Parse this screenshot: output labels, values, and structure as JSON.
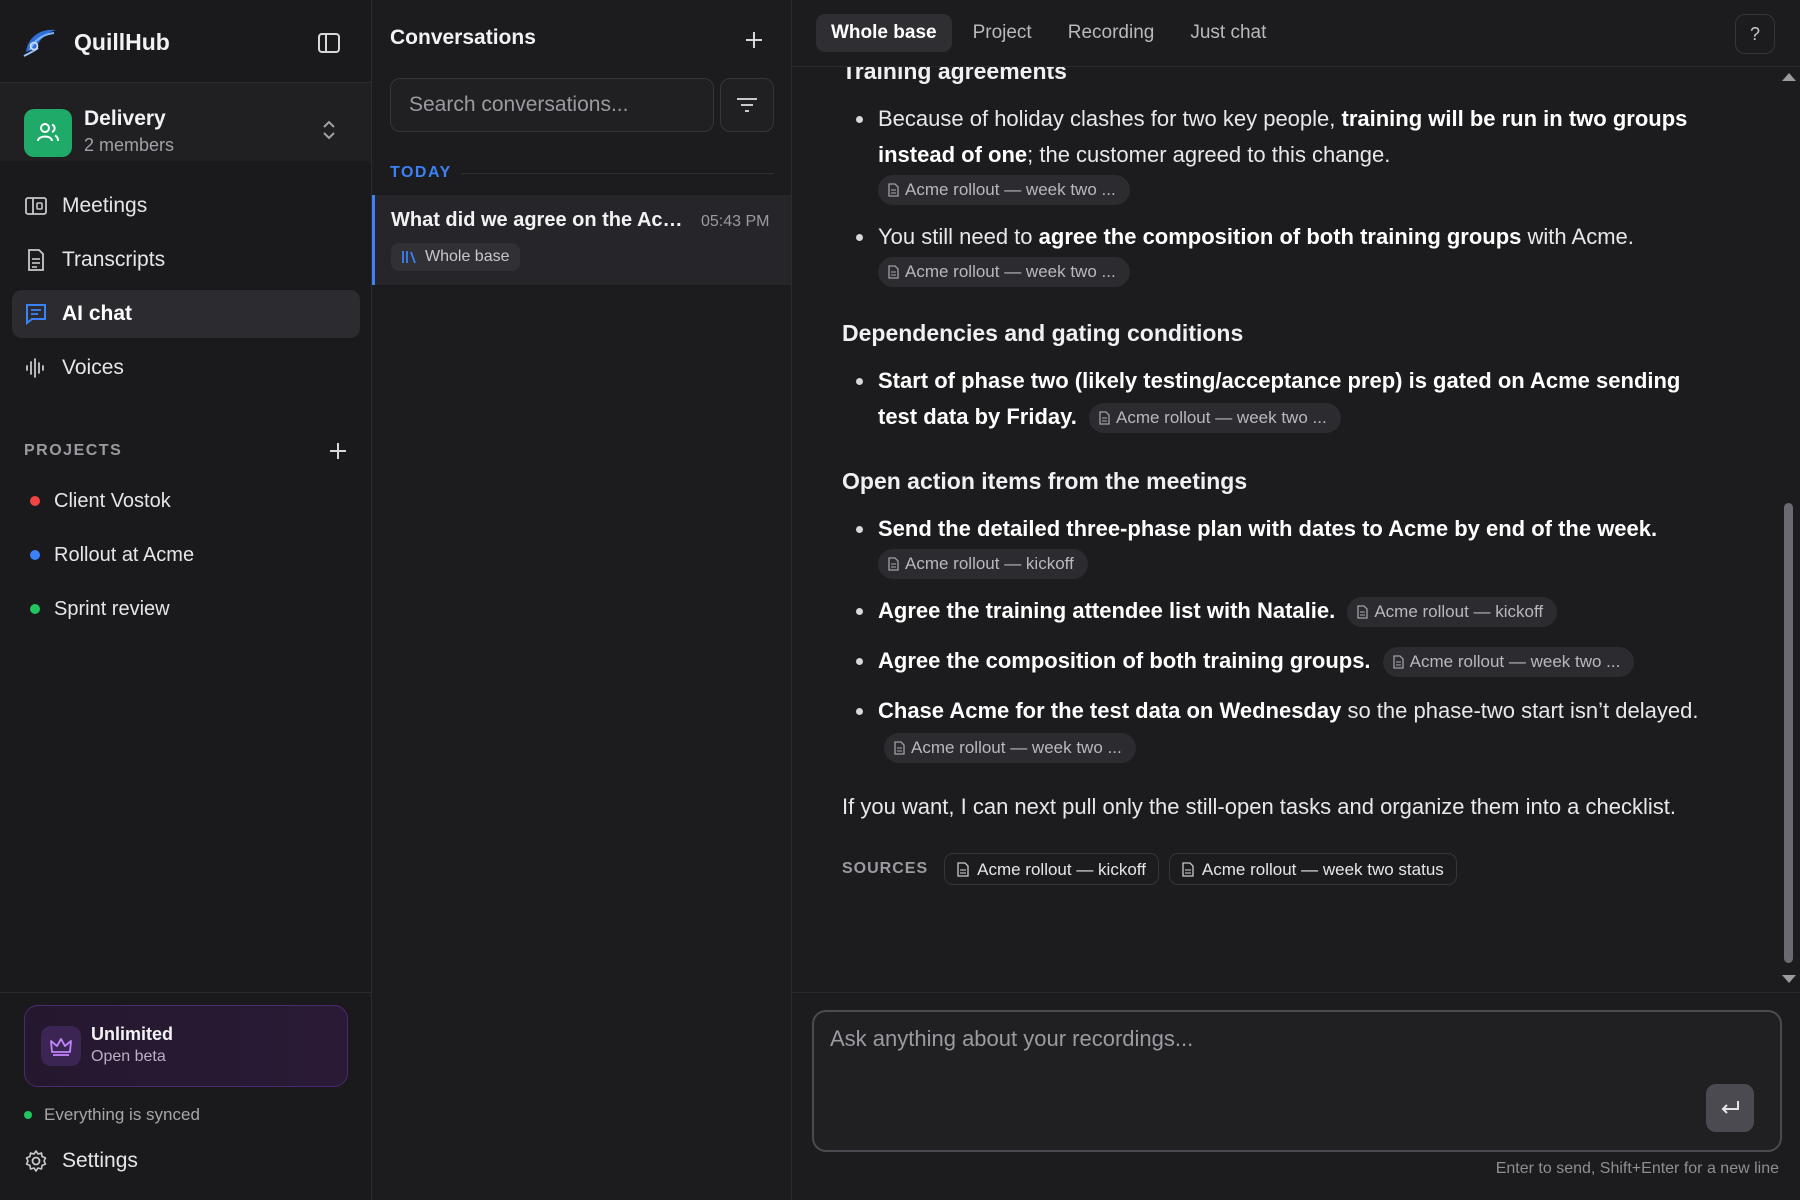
{
  "app": {
    "name": "QuillHub"
  },
  "workspace": {
    "name": "Delivery",
    "members": "2 members"
  },
  "nav": {
    "meetings": "Meetings",
    "transcripts": "Transcripts",
    "ai_chat": "AI chat",
    "voices": "Voices"
  },
  "projects": {
    "label": "PROJECTS",
    "items": [
      {
        "name": "Client Vostok",
        "color": "#ef4444"
      },
      {
        "name": "Rollout at Acme",
        "color": "#3b82f6"
      },
      {
        "name": "Sprint review",
        "color": "#22c55e"
      }
    ]
  },
  "plan": {
    "title": "Unlimited",
    "subtitle": "Open beta"
  },
  "sync_status": "Everything is synced",
  "settings_label": "Settings",
  "conversations": {
    "title": "Conversations",
    "search_placeholder": "Search conversations...",
    "group_label": "TODAY",
    "items": [
      {
        "title": "What did we agree on the Acme rollout?",
        "time": "05:43 PM",
        "scope": "Whole base"
      }
    ]
  },
  "tabs": [
    "Whole base",
    "Project",
    "Recording",
    "Just chat"
  ],
  "help_label": "?",
  "message": {
    "section_training": "Training agreements",
    "training_1_pre": "Because of holiday clashes for two key people, ",
    "training_1_bold": "training will be run in two groups instead of one",
    "training_1_post": "; the customer agreed to this change.",
    "training_1_cite": "Acme rollout — week two ...",
    "training_2_pre": "You still need to ",
    "training_2_bold": "agree the composition of both training groups",
    "training_2_post": " with Acme.",
    "training_2_cite": "Acme rollout — week two ...",
    "section_deps": "Dependencies and gating conditions",
    "deps_1_bold": "Start of phase two (likely testing/acceptance prep) is gated on Acme sending test data by Friday.",
    "deps_1_cite": "Acme rollout — week two ...",
    "section_actions": "Open action items from the meetings",
    "action_1_bold": "Send the detailed three-phase plan with dates to Acme by end of the week.",
    "action_1_cite": "Acme rollout — kickoff",
    "action_2_bold": "Agree the training attendee list with Natalie.",
    "action_2_cite": "Acme rollout — kickoff",
    "action_3_bold": "Agree the composition of both training groups.",
    "action_3_cite": "Acme rollout — week two ...",
    "action_4_bold": "Chase Acme for the test data on Wednesday",
    "action_4_post": " so the phase-two start isn’t delayed.",
    "action_4_cite": "Acme rollout — week two ...",
    "closing": "If you want, I can next pull only the still-open tasks and organize them into a checklist.",
    "sources_label": "SOURCES",
    "sources": [
      "Acme rollout — kickoff",
      "Acme rollout — week two status"
    ]
  },
  "composer": {
    "placeholder": "Ask anything about your recordings...",
    "hint": "Enter to send, Shift+Enter for a new line"
  }
}
